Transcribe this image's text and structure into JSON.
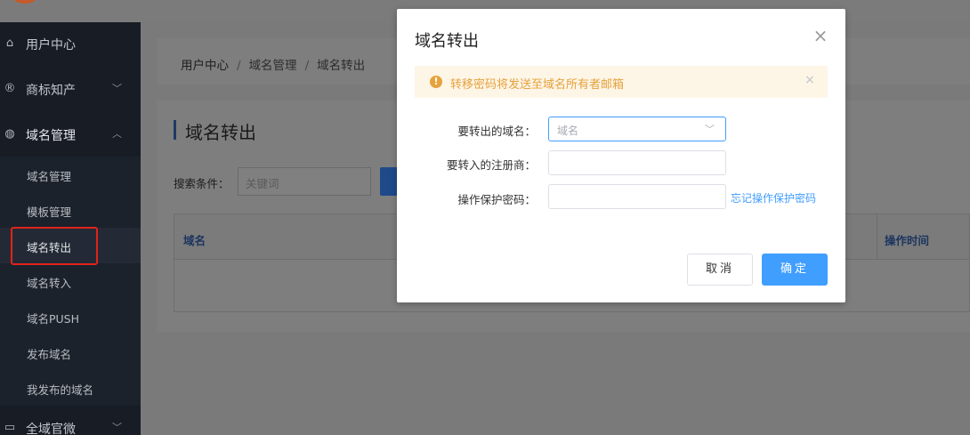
{
  "sidebar": {
    "groups": [
      {
        "icon": "home-icon",
        "label": "用户中心"
      },
      {
        "icon": "registered-icon",
        "label": "商标知产"
      },
      {
        "icon": "globe-icon",
        "label": "域名管理"
      },
      {
        "icon": "monitor-icon",
        "label": "全域官微"
      }
    ],
    "sub_items": [
      {
        "label": "域名管理"
      },
      {
        "label": "模板管理"
      },
      {
        "label": "域名转出"
      },
      {
        "label": "域名转入"
      },
      {
        "label": "域名PUSH"
      },
      {
        "label": "发布域名"
      },
      {
        "label": "我发布的域名"
      }
    ]
  },
  "breadcrumb": {
    "items": [
      "用户中心",
      "域名管理",
      "域名转出"
    ],
    "separator": "/"
  },
  "page": {
    "title": "域名转出",
    "search_label": "搜索条件：",
    "search_placeholder": "关键词",
    "table_columns": [
      "域名",
      "操作时间"
    ]
  },
  "modal": {
    "title": "域名转出",
    "alert_text": "转移密码将发送至域名所有者邮箱",
    "fields": {
      "domain_label": "要转出的域名：",
      "domain_placeholder": "域名",
      "registrar_label": "要转入的注册商：",
      "password_label": "操作保护密码：",
      "forgot_link": "忘记操作保护密码"
    },
    "cancel_label": "取消",
    "confirm_label": "确定"
  },
  "colors": {
    "primary": "#409eff",
    "warning": "#e6a23c",
    "highlight": "#e2231a",
    "sidebar_bg": "#171c25"
  }
}
